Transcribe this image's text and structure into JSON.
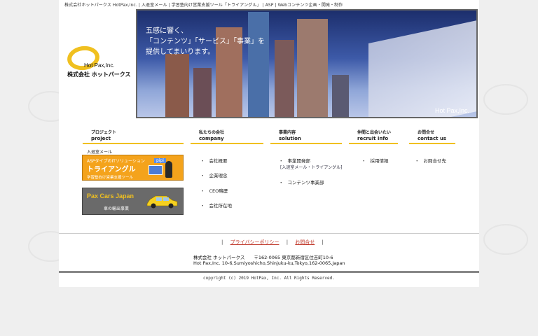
{
  "header": {
    "tagline": "株式会社ホットパークス HotPax,Inc. | 入退室メール | 学習塾向け営業支援ツール「トライアングル」 | ASP | Webコンテンツ企画・開発・制作"
  },
  "logo": {
    "name": "Hot Pax,Inc.",
    "jp": "株式会社 ホットパークス",
    "color": "#f0c020"
  },
  "hero": {
    "line1": "五感に響く、",
    "line2": "「コンテンツ」「サービス」「事業」を",
    "line3": "提供してまいります。",
    "brand": "Hot Pax,Inc."
  },
  "nav": {
    "project": {
      "jp": "プロジェクト",
      "en": "project"
    },
    "company": {
      "jp": "私たちの会社",
      "en": "company"
    },
    "solution": {
      "jp": "事業内容",
      "en": "solution"
    },
    "recruit": {
      "jp": "仲間と出会いたい",
      "en": "recruit info"
    },
    "contact": {
      "jp": "お問合せ",
      "en": "contact us"
    }
  },
  "company_links": [
    "会社概要",
    "企業理念",
    "CEO略歴",
    "会社所在地"
  ],
  "solution_links": {
    "dept1": "事業開発部",
    "dept1_sub": "[入退室メール・トライアングル]",
    "dept2": "コンテンツ事業部"
  },
  "recruit_links": [
    "採用情報"
  ],
  "contact_links": [
    "お問合せ先"
  ],
  "banner_triangle": {
    "label": "入退室メール",
    "line1": "ASPタイプのITソリューション",
    "title": "トライアングル",
    "line3": "学習塾向け営業支援ツール",
    "tag": "pipi"
  },
  "banner_paxcars": {
    "title": "Pax Cars Japan",
    "sub": "車の輸出事業"
  },
  "footer": {
    "sep": "|",
    "privacy": "プライバシーポリシー",
    "inquiry": "お問合せ",
    "address_jp": "株式会社 ホットパークス　　〒162-0065 東京都新宿区住吉町10-6",
    "address_en": "Hot Pax,Inc. 10-6,Sumiyoshicho,Shinjuku-ku,Tokyo,162-0065,Japan",
    "copyright": "copyright (c) 2019 HotPax, Inc. All Rights Reserved."
  }
}
